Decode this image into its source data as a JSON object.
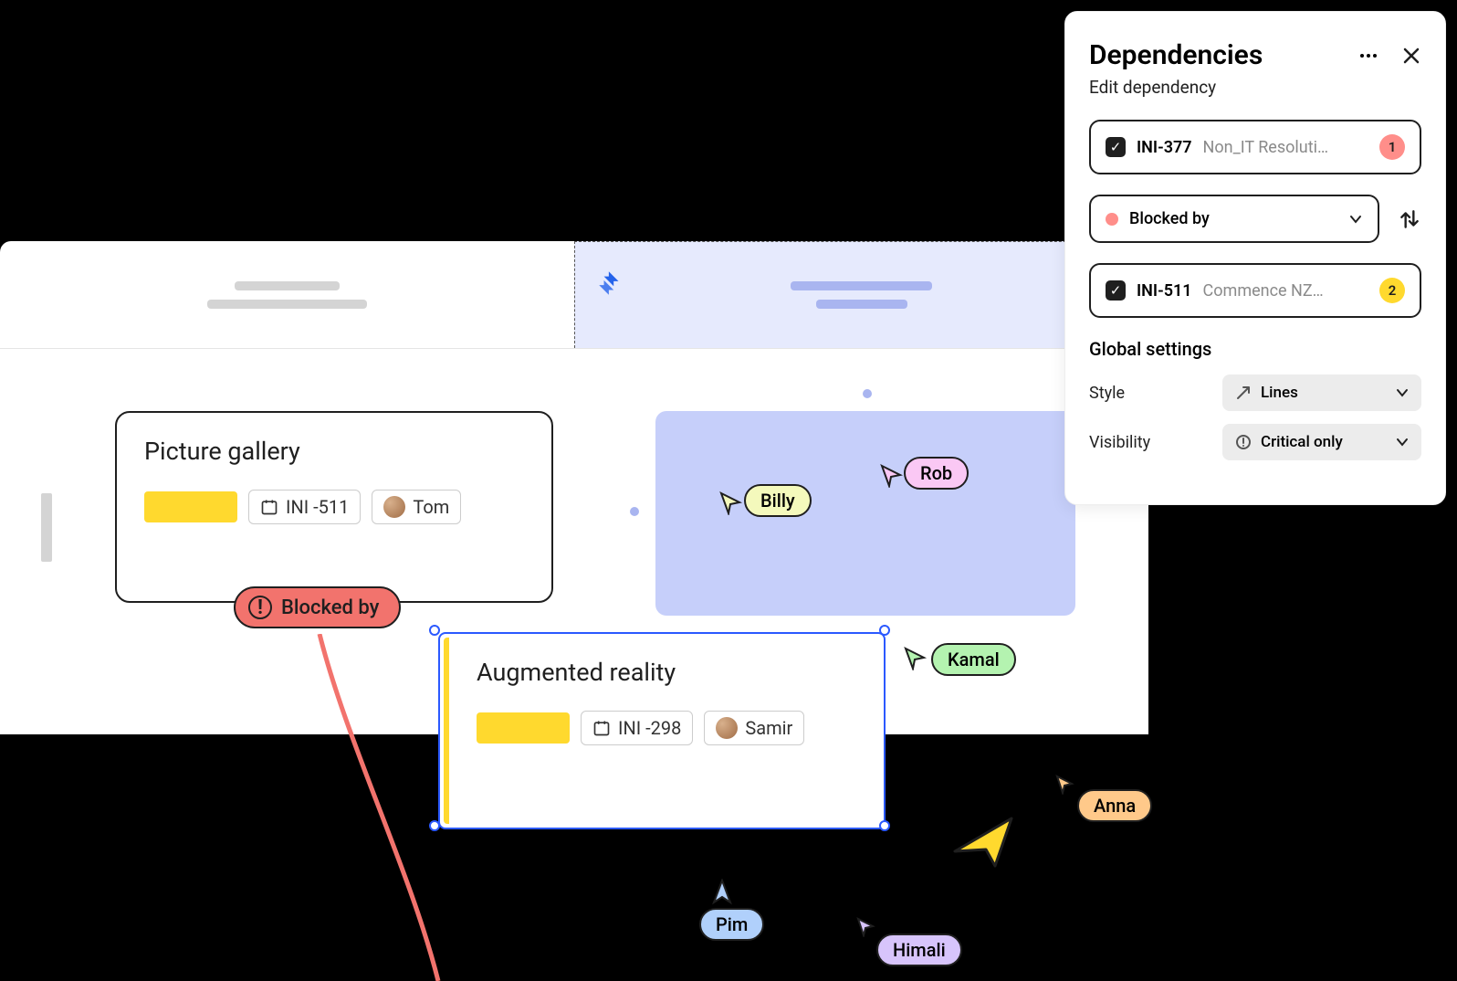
{
  "panel": {
    "title": "Dependencies",
    "subtitle": "Edit dependency",
    "item1": {
      "id": "INI-377",
      "name": "Non_IT Resoluti…",
      "count": "1"
    },
    "relation": {
      "label": "Blocked by"
    },
    "item2": {
      "id": "INI-511",
      "name": "Commence NZ…",
      "count": "2"
    },
    "global": {
      "heading": "Global settings",
      "style_label": "Style",
      "style_value": "Lines",
      "visibility_label": "Visibility",
      "visibility_value": "Critical only"
    }
  },
  "cards": {
    "picture": {
      "title": "Picture gallery",
      "ticket": "INI -511",
      "assignee": "Tom"
    },
    "ar": {
      "title": "Augmented reality",
      "ticket": "INI -298",
      "assignee": "Samir"
    }
  },
  "blocked_badge": "Blocked by",
  "collaborators": {
    "billy": "Billy",
    "rob": "Rob",
    "kamal": "Kamal",
    "anna": "Anna",
    "pim": "Pim",
    "himali": "Himali"
  }
}
